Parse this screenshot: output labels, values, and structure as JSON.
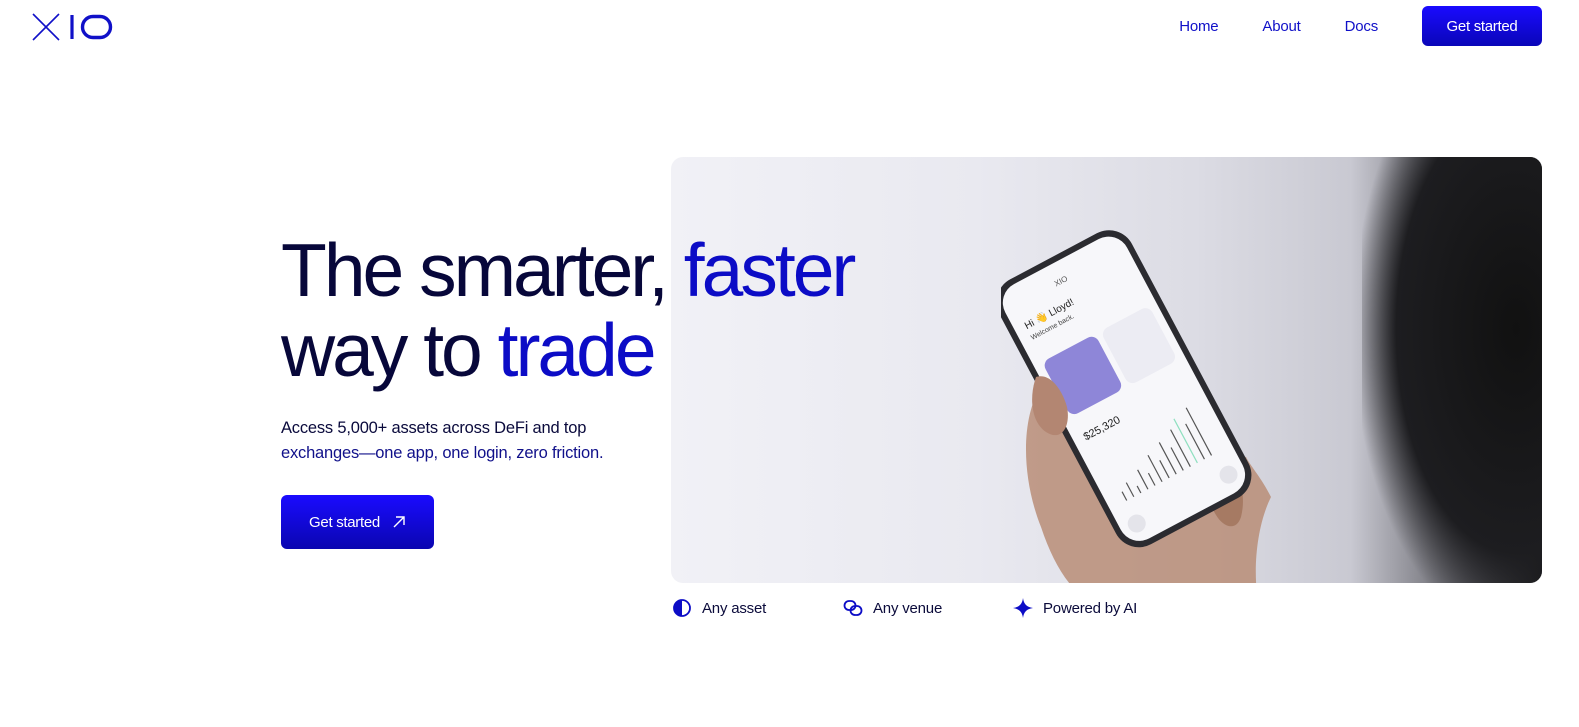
{
  "header": {
    "logo_alt": "XIO",
    "nav": [
      {
        "label": "Home"
      },
      {
        "label": "About"
      },
      {
        "label": "Docs"
      }
    ],
    "cta_label": "Get started"
  },
  "hero": {
    "title_line1_dark": "The smarter,",
    "title_line1_accent": " faster",
    "title_line2_dark": "way to ",
    "title_line2_accent": "trade",
    "subtitle_part1": "Access 5,000+ assets across DeFi and top",
    "subtitle_part2": "exchanges—one app, one login, zero friction.",
    "cta_label": "Get started"
  },
  "phone_screen": {
    "greeting": "Hi 👋 Lloyd!",
    "welcome": "Welcome back.",
    "balance": "$25,320"
  },
  "features": [
    {
      "icon": "half-circle-icon",
      "label": "Any asset"
    },
    {
      "icon": "link-icon",
      "label": "Any venue"
    },
    {
      "icon": "sparkle-icon",
      "label": "Powered by AI"
    }
  ],
  "colors": {
    "accent": "#0c0cc6",
    "button": "#1a0bff",
    "text_dark": "#07073a"
  }
}
